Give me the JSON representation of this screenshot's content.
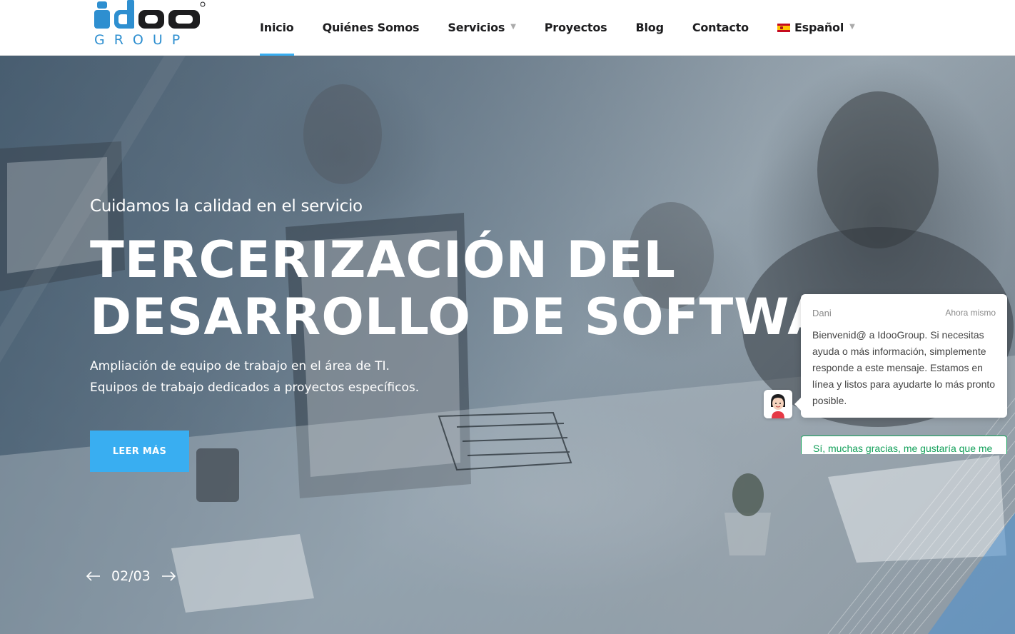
{
  "header": {
    "logo_text_main": "idoo",
    "logo_text_sub": "GROUP",
    "nav": [
      {
        "label": "Inicio",
        "active": true,
        "has_caret": false
      },
      {
        "label": "Quiénes Somos",
        "active": false,
        "has_caret": false
      },
      {
        "label": "Servicios",
        "active": false,
        "has_caret": true
      },
      {
        "label": "Proyectos",
        "active": false,
        "has_caret": false
      },
      {
        "label": "Blog",
        "active": false,
        "has_caret": false
      },
      {
        "label": "Contacto",
        "active": false,
        "has_caret": false
      }
    ],
    "language": {
      "label": "Español",
      "icon": "spain-flag-icon"
    },
    "caret": "▼"
  },
  "hero": {
    "subtitle": "Cuidamos la calidad en el servicio",
    "title_line1": "TERCERIZACIÓN DEL",
    "title_line2": "DESARROLLO DE SOFTWARE",
    "desc_line1": "Ampliación de equipo de trabajo en el área de TI.",
    "desc_line2": "Equipos de trabajo dedicados a proyectos específicos.",
    "cta_label": "LEER MÁS",
    "slide_counter": "02/03"
  },
  "chat": {
    "sender": "Dani",
    "time": "Ahora mismo",
    "message": "Bienvenid@ a IdooGroup. Si necesitas ayuda o más información, simplemente responde a este mensaje. Estamos en línea y listos para ayudarte lo más pronto posible.",
    "reply_option": "Sí, muchas gracias, me gustaría que me"
  },
  "colors": {
    "accent": "#39aef1",
    "logo_blue": "#2e8fd0",
    "logo_dark": "#1d1d1f",
    "chat_green": "#13a05a"
  }
}
